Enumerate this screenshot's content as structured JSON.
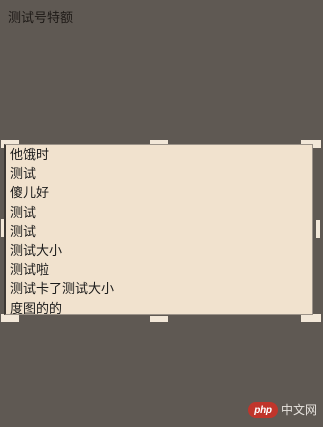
{
  "page": {
    "title": "测试号特额"
  },
  "listbox": {
    "items": [
      "他饿时",
      "测试",
      "傻儿好",
      "测试",
      "测试",
      "测试大小",
      "测试啦",
      "测试卡了测试大小",
      "度图的的"
    ]
  },
  "watermark": {
    "badge": "php",
    "text": "中文网"
  },
  "colors": {
    "page_background": "#5f5953",
    "listbox_background": "#f1e2ce",
    "handle": "#f2e7d8",
    "watermark_badge": "#c0352b"
  }
}
